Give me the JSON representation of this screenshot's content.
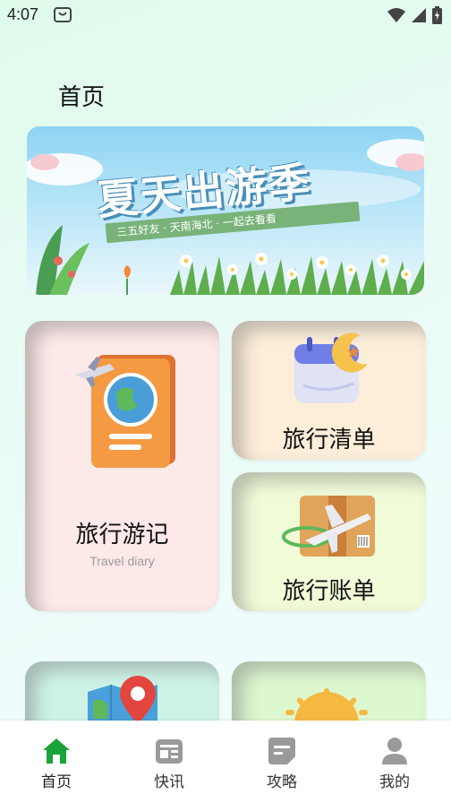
{
  "status_bar": {
    "time": "4:07"
  },
  "header": {
    "title": "首页"
  },
  "banner": {
    "title": "夏天出游季",
    "subtitle": "三五好友 · 天南海北 · 一起去看看"
  },
  "cards": {
    "travel_diary": {
      "label": "旅行游记",
      "sublabel": "Travel diary"
    },
    "checklist": {
      "label": "旅行清单"
    },
    "bill": {
      "label": "旅行账单"
    }
  },
  "tabbar": {
    "items": [
      {
        "label": "首页",
        "icon": "home-icon",
        "active": true
      },
      {
        "label": "快讯",
        "icon": "news-icon",
        "active": false
      },
      {
        "label": "攻略",
        "icon": "guide-icon",
        "active": false
      },
      {
        "label": "我的",
        "icon": "person-icon",
        "active": false
      }
    ],
    "active_color": "#1aa33a",
    "inactive_color": "#9a9a9a"
  }
}
